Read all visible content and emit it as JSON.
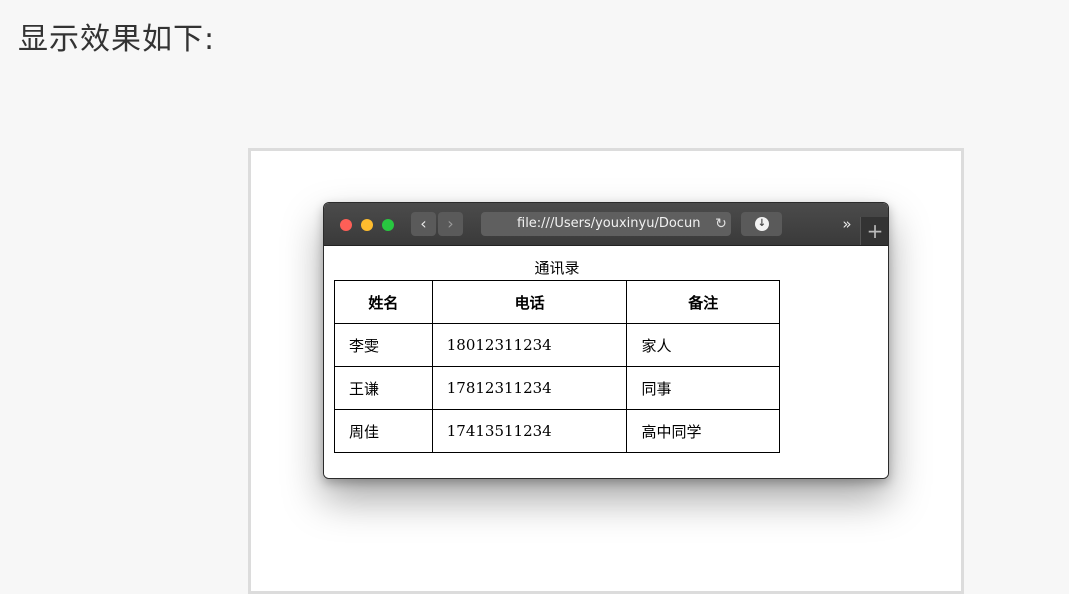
{
  "intro_text": "显示效果如下:",
  "browser": {
    "url": "file:///Users/youxinyu/Docun",
    "back_glyph": "‹",
    "forward_glyph": "›",
    "reload_glyph": "↻",
    "download_glyph": "↓",
    "more_glyph": "»",
    "new_tab_glyph": "+"
  },
  "table": {
    "caption": "通讯录",
    "headers": [
      "姓名",
      "电话",
      "备注"
    ],
    "rows": [
      [
        "李雯",
        "18012311234",
        "家人"
      ],
      [
        "王谦",
        "17812311234",
        "同事"
      ],
      [
        "周佳",
        "17413511234",
        "高中同学"
      ]
    ]
  },
  "colors": {
    "traffic_red": "#fe5f57",
    "traffic_yellow": "#febc2e",
    "traffic_green": "#28c840",
    "titlebar": "#3e3e3e"
  }
}
